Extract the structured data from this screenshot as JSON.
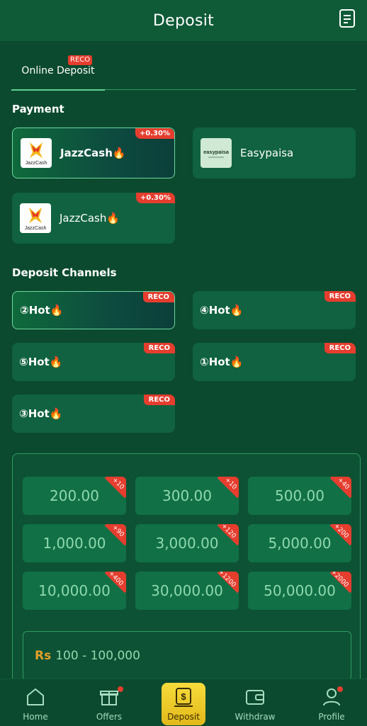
{
  "header": {
    "title": "Deposit",
    "doc_icon": "document-icon"
  },
  "tabs": [
    {
      "label": "Online Deposit",
      "badge": "RECO"
    }
  ],
  "payment": {
    "title": "Payment",
    "methods": [
      {
        "label": "JazzCash🔥",
        "logo_text": "JazzCash",
        "rate": "+0.30%"
      },
      {
        "label": "Easypaisa",
        "logo_text": "easypaisa"
      },
      {
        "label": "JazzCash🔥",
        "logo_text": "JazzCash",
        "rate": "+0.30%"
      }
    ]
  },
  "channels": {
    "title": "Deposit Channels",
    "items": [
      {
        "label": "②Hot🔥",
        "badge": "RECO"
      },
      {
        "label": "④Hot🔥",
        "badge": "RECO"
      },
      {
        "label": "⑤Hot🔥",
        "badge": "RECO"
      },
      {
        "label": "①Hot🔥",
        "badge": "RECO"
      },
      {
        "label": "③Hot🔥",
        "badge": "RECO"
      }
    ]
  },
  "amounts": [
    {
      "value": "200.00",
      "bonus": "+10"
    },
    {
      "value": "300.00",
      "bonus": "+10"
    },
    {
      "value": "500.00",
      "bonus": "+40"
    },
    {
      "value": "1,000.00",
      "bonus": "+90"
    },
    {
      "value": "3,000.00",
      "bonus": "+120"
    },
    {
      "value": "5,000.00",
      "bonus": "+200"
    },
    {
      "value": "10,000.00",
      "bonus": "+400"
    },
    {
      "value": "30,000.00",
      "bonus": "+1200"
    },
    {
      "value": "50,000.00",
      "bonus": "+2000"
    }
  ],
  "range": {
    "currency": "Rs",
    "text": "100 - 100,000"
  },
  "nav": {
    "home": "Home",
    "offers": "Offers",
    "deposit": "Deposit",
    "withdraw": "Withdraw",
    "profile": "Profile"
  },
  "colors": {
    "background": "#0b4a2e",
    "accent": "#e53d2e",
    "deposit_button": "#f0cc2a"
  }
}
